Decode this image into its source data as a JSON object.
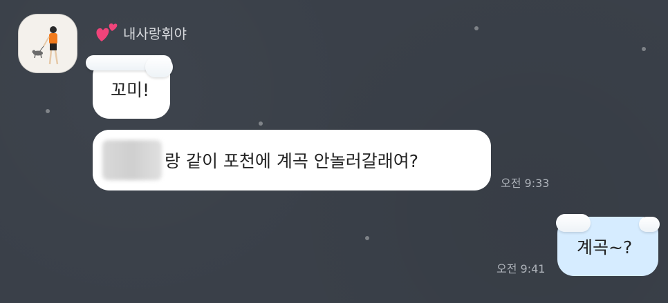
{
  "chat": {
    "sender": {
      "name": "내사랑휘야",
      "heart_icon": "two-hearts-emoji"
    },
    "messages": [
      {
        "direction": "incoming",
        "text": "꼬미!"
      },
      {
        "direction": "incoming",
        "text": "랑 같이 포천에 계곡 안놀러갈래여?",
        "time": "오전 9:33",
        "has_blurred_name": true
      },
      {
        "direction": "outgoing",
        "text": "계곡~?",
        "time": "오전 9:41"
      }
    ]
  },
  "colors": {
    "background": "#3a4049",
    "incoming_bubble": "#ffffff",
    "outgoing_bubble": "#d6ecff",
    "timestamp": "#aeb3ba"
  }
}
